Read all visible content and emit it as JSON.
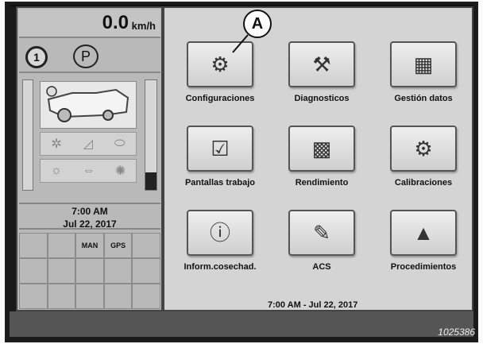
{
  "status": {
    "speed_value": "0.0",
    "speed_unit": "km/h",
    "gear": "1",
    "park": "P",
    "time": "7:00 AM",
    "date": "Jul 22, 2017",
    "shortcut_man": "MAN",
    "shortcut_gps": "GPS"
  },
  "menu": {
    "items": [
      {
        "label": "Configuraciones",
        "icon": "settings-icon"
      },
      {
        "label": "Diagnosticos",
        "icon": "diagnostics-icon"
      },
      {
        "label": "Gestión datos",
        "icon": "data-management-icon"
      },
      {
        "label": "Pantallas trabajo",
        "icon": "work-screens-icon"
      },
      {
        "label": "Rendimiento",
        "icon": "performance-icon"
      },
      {
        "label": "Calibraciones",
        "icon": "calibration-icon"
      },
      {
        "label": "Inform.cosechad.",
        "icon": "harvester-info-icon"
      },
      {
        "label": "ACS",
        "icon": "acs-icon"
      },
      {
        "label": "Procedimientos",
        "icon": "procedures-icon"
      }
    ]
  },
  "footer": {
    "datetime": "7:00 AM - Jul 22, 2017",
    "reference": "1025386"
  },
  "callout": "A"
}
